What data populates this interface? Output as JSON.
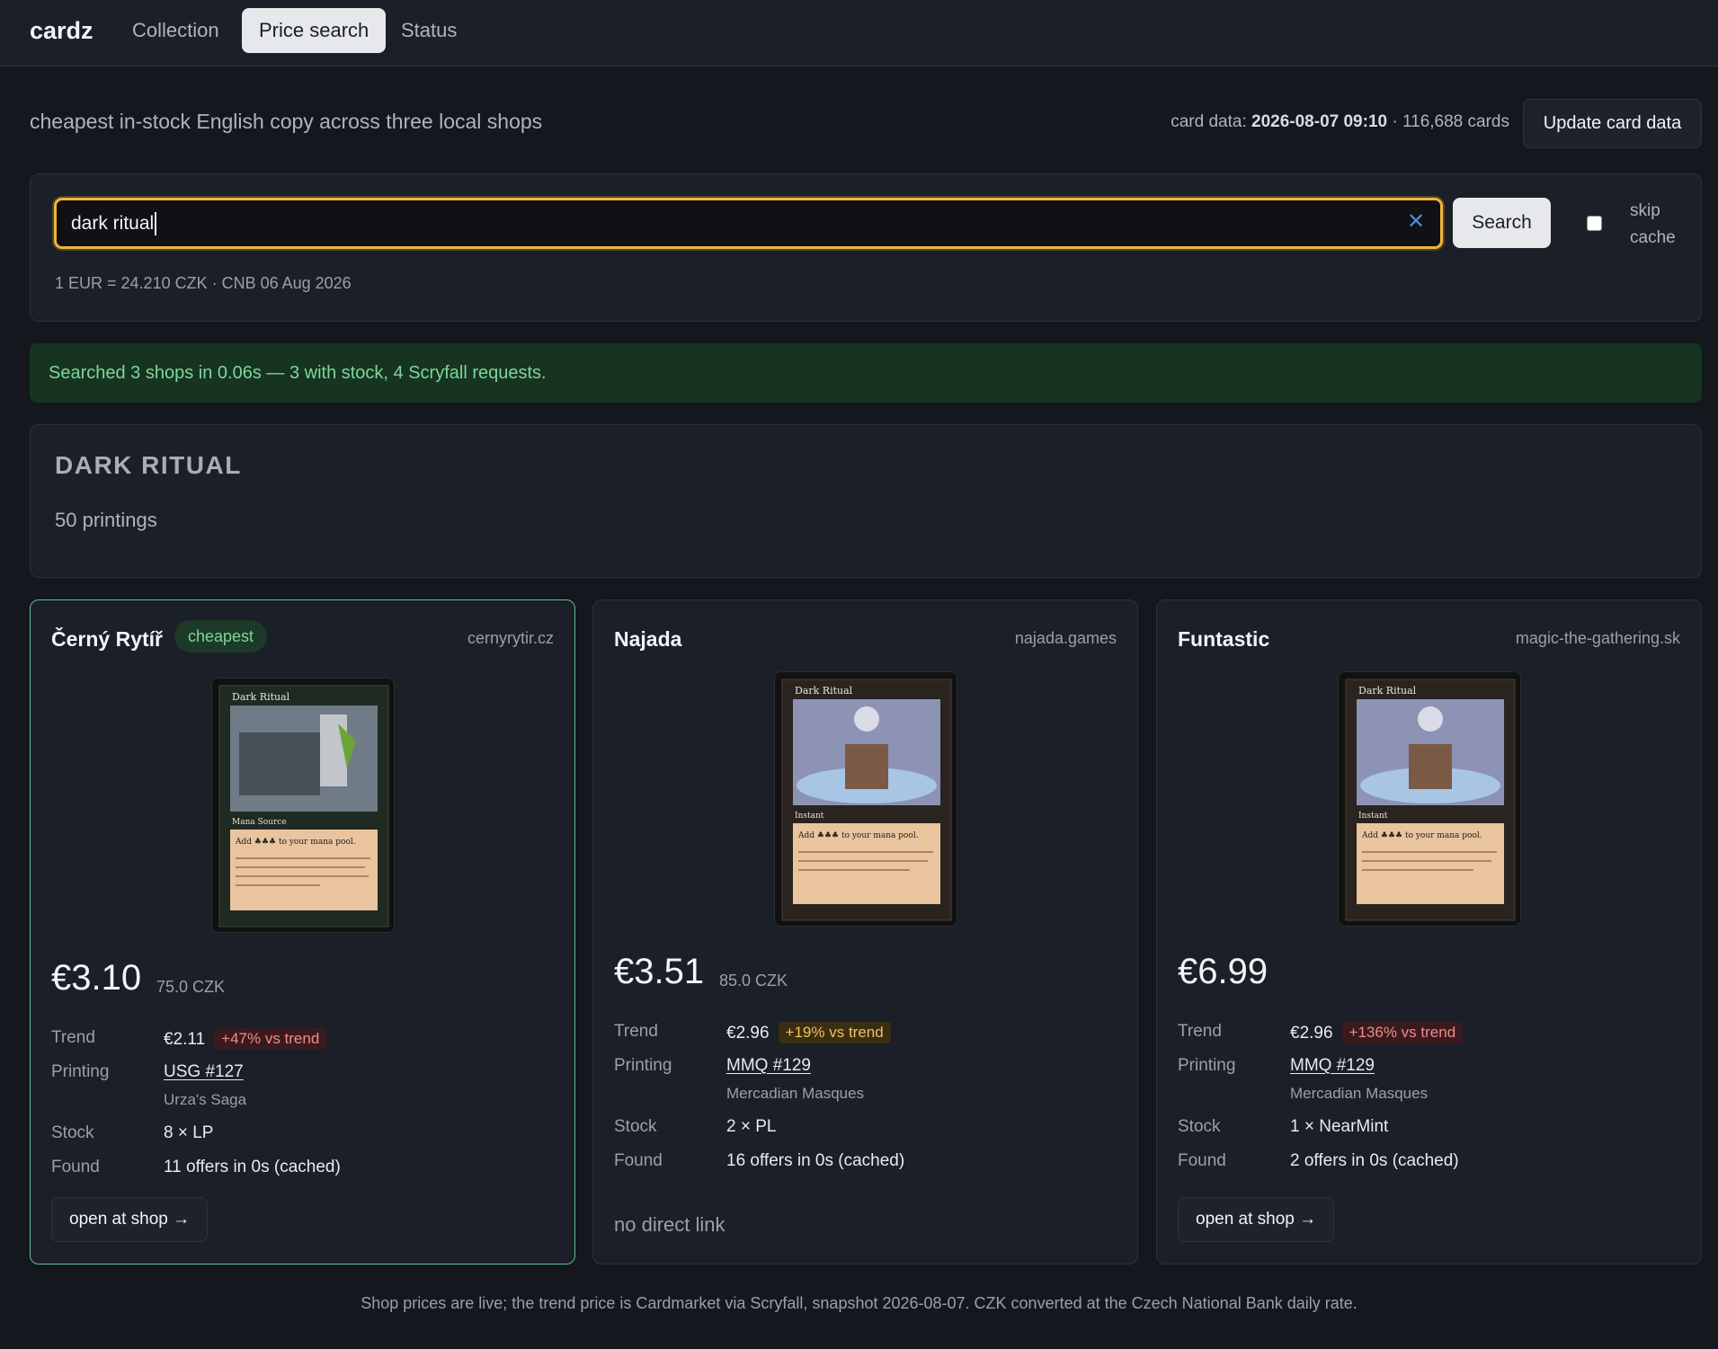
{
  "nav": {
    "brand": "cardz",
    "tabs": [
      {
        "label": "Collection",
        "active": false
      },
      {
        "label": "Price search",
        "active": true
      },
      {
        "label": "Status",
        "active": false
      }
    ]
  },
  "header": {
    "subtitle": "cheapest in-stock English copy across three local shops",
    "card_data_label": "card data:",
    "card_data_timestamp": "2026-08-07 09:10",
    "card_count": "· 116,688 cards",
    "update_button": "Update card data"
  },
  "search": {
    "query": "dark ritual",
    "clear_icon": "close-icon",
    "button": "Search",
    "skip_cache_label_1": "skip",
    "skip_cache_label_2": "cache",
    "skip_cache_checked": false,
    "rate": "1 EUR = 24.210 CZK · CNB 06 Aug 2026"
  },
  "status": {
    "message": "Searched 3 shops in 0.06s — 3 with stock, 4 Scryfall requests.",
    "color": "#7fd69a"
  },
  "card": {
    "name": "DARK RITUAL",
    "printings": "50 printings"
  },
  "labels": {
    "trend": "Trend",
    "printing": "Printing",
    "stock": "Stock",
    "found": "Found"
  },
  "shops": [
    {
      "name": "Černý Rytíř",
      "badge": "cheapest",
      "domain": "cernyrytir.cz",
      "price_eur": "€3.10",
      "price_czk": "75.0 CZK",
      "trend": "€2.11",
      "trend_delta": "+47% vs trend",
      "printing": "USG #127",
      "set_name": "Urza's Saga",
      "stock": "8 × LP",
      "found": "11 offers in 0s (cached)",
      "action": "open at shop →",
      "card_image_title": "Dark Ritual",
      "card_image_type": "Mana Source",
      "card_image_rules": "Add ♣♣♣ to your mana pool."
    },
    {
      "name": "Najada",
      "domain": "najada.games",
      "price_eur": "€3.51",
      "price_czk": "85.0 CZK",
      "trend": "€2.96",
      "trend_delta": "+19% vs trend",
      "printing": "MMQ #129",
      "set_name": "Mercadian Masques",
      "stock": "2 × PL",
      "found": "16 offers in 0s (cached)",
      "action": "no direct link",
      "card_image_title": "Dark Ritual",
      "card_image_type": "Instant",
      "card_image_rules": "Add ♣♣♣ to your mana pool."
    },
    {
      "name": "Funtastic",
      "domain": "magic-the-gathering.sk",
      "price_eur": "€6.99",
      "trend": "€2.96",
      "trend_delta": "+136% vs trend",
      "printing": "MMQ #129",
      "set_name": "Mercadian Masques",
      "stock": "1 × NearMint",
      "found": "2 offers in 0s (cached)",
      "action": "open at shop →",
      "card_image_title": "Dark Ritual",
      "card_image_type": "Instant",
      "card_image_rules": "Add ♣♣♣ to your mana pool."
    }
  ],
  "footer": "Shop prices are live; the trend price is Cardmarket via Scryfall, snapshot 2026-08-07. CZK converted at the Czech National Bank daily rate."
}
